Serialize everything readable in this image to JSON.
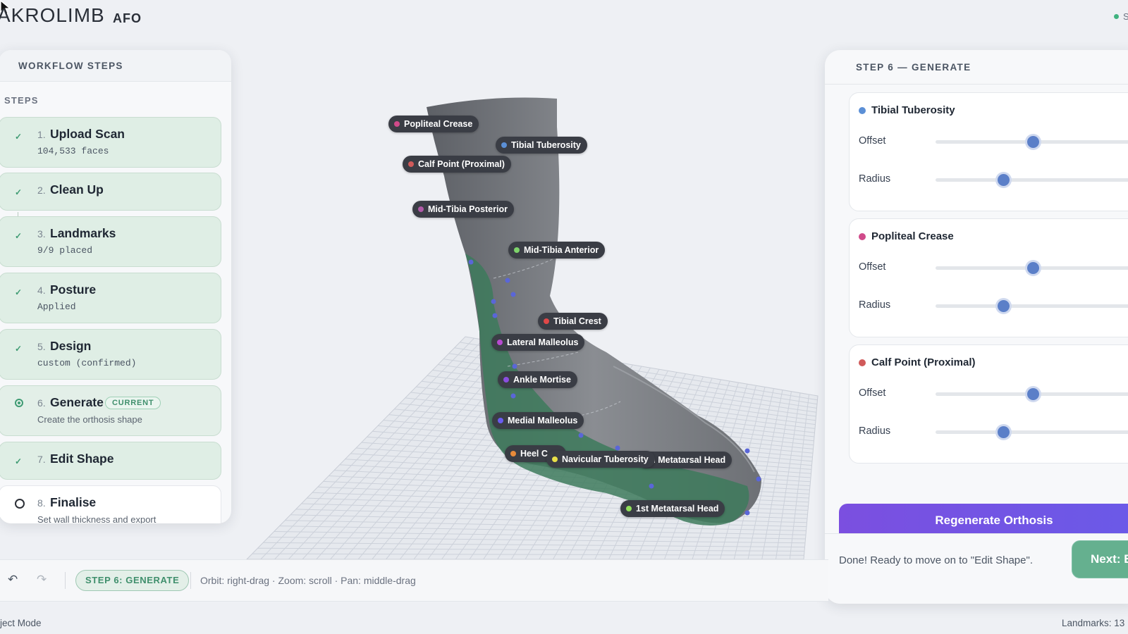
{
  "app": {
    "logo": "AKROLIMB",
    "logo_suffix": "AFO",
    "status_letter": "S"
  },
  "left_panel": {
    "title": "WORKFLOW STEPS",
    "section_label": "STEPS",
    "steps": [
      {
        "num": "1.",
        "title": "Upload Scan",
        "sub": "104,533 faces",
        "state": "done"
      },
      {
        "num": "2.",
        "title": "Clean Up",
        "sub": "",
        "state": "done"
      },
      {
        "num": "3.",
        "title": "Landmarks",
        "sub": "9/9 placed",
        "state": "done"
      },
      {
        "num": "4.",
        "title": "Posture",
        "sub": "Applied",
        "state": "done"
      },
      {
        "num": "5.",
        "title": "Design",
        "sub": "custom (confirmed)",
        "state": "done"
      },
      {
        "num": "6.",
        "title": "Generate",
        "sub": "Create the orthosis shape",
        "badge": "CURRENT",
        "state": "current"
      },
      {
        "num": "7.",
        "title": "Edit Shape",
        "sub": "",
        "state": "done"
      },
      {
        "num": "8.",
        "title": "Finalise",
        "sub": "Set wall thickness and export",
        "state": "todo"
      }
    ]
  },
  "right_panel": {
    "title": "STEP 6 — GENERATE",
    "landmarks": [
      {
        "name": "Tibial Tuberosity",
        "color": "#5b8fd6",
        "offset_label": "Offset",
        "offset": 0.46,
        "radius_label": "Radius",
        "radius": 0.32
      },
      {
        "name": "Popliteal Crease",
        "color": "#d04a8a",
        "offset_label": "Offset",
        "offset": 0.46,
        "radius_label": "Radius",
        "radius": 0.32
      },
      {
        "name": "Calf Point (Proximal)",
        "color": "#d05a5a",
        "offset_label": "Offset",
        "offset": 0.46,
        "radius_label": "Radius",
        "radius": 0.32
      }
    ],
    "regenerate_label": "Regenerate Orthosis",
    "done_text": "Done! Ready to move on to \"Edit Shape\".",
    "next_label": "Next: E"
  },
  "toolbar": {
    "undo_icon": "undo-icon",
    "redo_icon": "redo-icon",
    "step_badge": "STEP 6: GENERATE",
    "hint": "Orbit: right-drag · Zoom: scroll · Pan: middle-drag"
  },
  "statusbar": {
    "mode": "ject Mode",
    "landmarks": "Landmarks: 13"
  },
  "viewport_labels": [
    {
      "text": "Popliteal Crease",
      "color": "#d04a8a"
    },
    {
      "text": "Tibial Tuberosity",
      "color": "#5b8fd6"
    },
    {
      "text": "Calf Point (Proximal)",
      "color": "#d05a5a"
    },
    {
      "text": "Mid-Tibia Posterior",
      "color": "#b05aa8"
    },
    {
      "text": "Mid-Tibia Anterior",
      "color": "#7ed36b"
    },
    {
      "text": "Tibial Crest",
      "color": "#e04848"
    },
    {
      "text": "Lateral Malleolus",
      "color": "#b74ad0"
    },
    {
      "text": "Ankle Mortise",
      "color": "#8a4ee0"
    },
    {
      "text": "Medial Malleolus",
      "color": "#6a5cf0"
    },
    {
      "text": "Heel C",
      "color": "#e88a3a"
    },
    {
      "text": "Navicular Tuberosity",
      "color": "#e8e048"
    },
    {
      "text": "th Metatarsal Head",
      "color": "#3a3d45"
    },
    {
      "text": "1st Metatarsal Head",
      "color": "#8fe05a"
    }
  ]
}
